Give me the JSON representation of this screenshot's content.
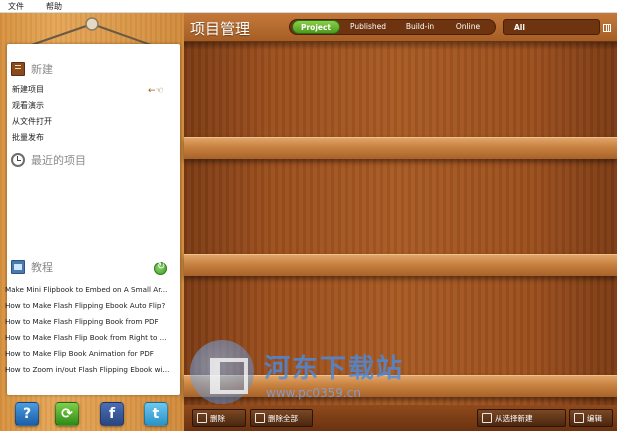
{
  "menubar": {
    "file": "文件",
    "help": "帮助"
  },
  "left_panel": {
    "new_section": {
      "label": "新建",
      "items": [
        "新建项目",
        "观看演示",
        "从文件打开",
        "批量发布"
      ]
    },
    "recent_section": {
      "label": "最近的项目"
    },
    "tutorial_section": {
      "label": "教程",
      "items": [
        "Make Mini Flipbook to Embed on A Small Ar...",
        "How to Make Flash Flipping Ebook Auto Flip?",
        "How to Make Flash Flipping Book from PDF",
        "How to Make Flash Flip Book from Right to ...",
        "How to Make Flip Book Animation for PDF",
        "How to Zoom in/out Flash Flipping Ebook wi..."
      ]
    },
    "social": {
      "help_glyph": "?",
      "facebook_glyph": "f",
      "twitter_glyph": "t"
    },
    "pointer_glyph": "←☜"
  },
  "header": {
    "title": "项目管理",
    "tabs": [
      "Project",
      "Published",
      "Build-in",
      "Online"
    ],
    "active_tab": "Project",
    "filter_value": "All"
  },
  "bottom_bar": {
    "delete": "删除",
    "delete_all": "删除全部",
    "from_template": "从选择新建",
    "edit": "编辑"
  },
  "watermark": {
    "text": "河东下载站",
    "url": "www.pc0359.cn"
  },
  "colors": {
    "shelf_wood": "#a85a24",
    "frame_wood": "#e4a556",
    "active_tab": "#6bb83a"
  }
}
